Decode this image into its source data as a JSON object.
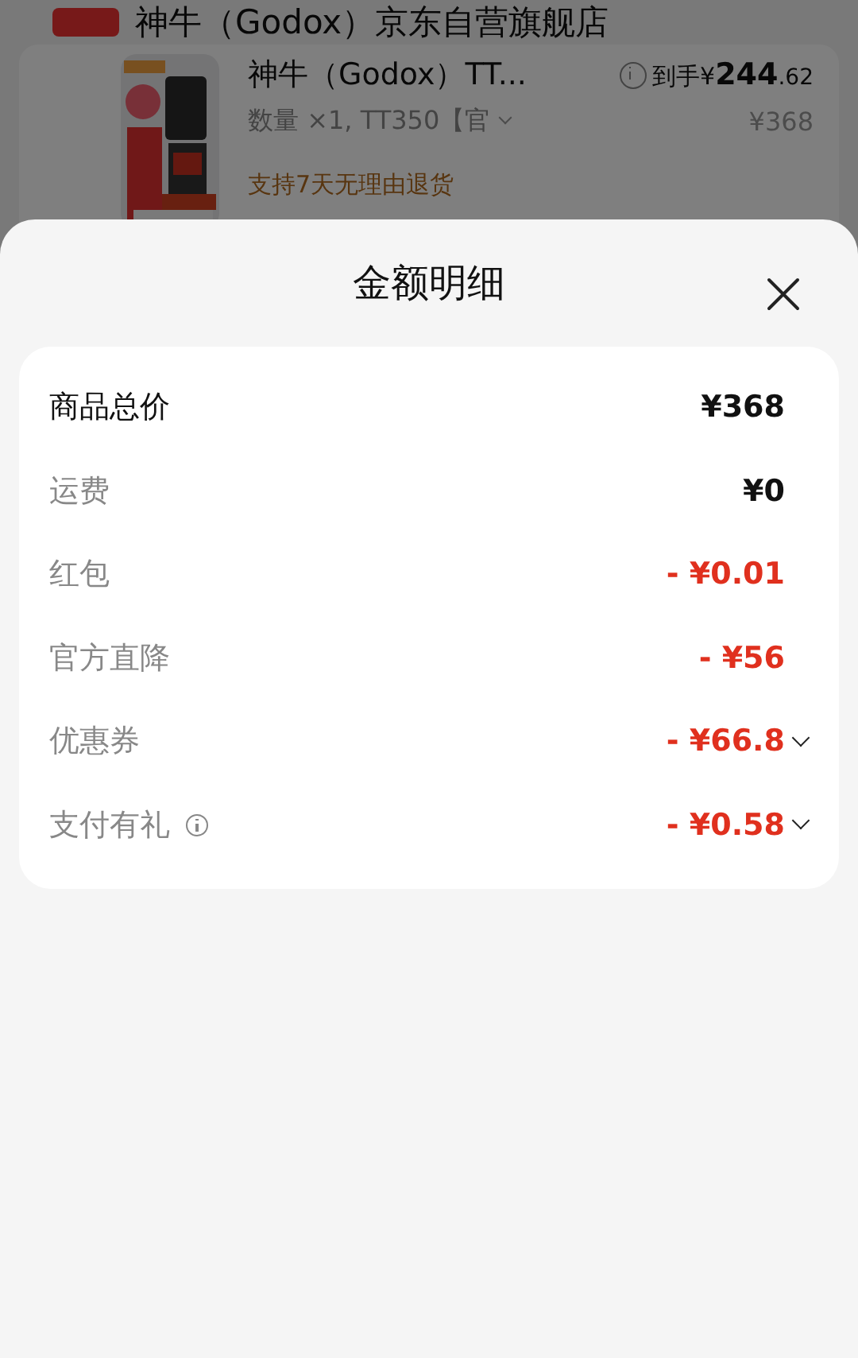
{
  "background_page": {
    "store_name": "神牛（Godox）京东自营旗舰店",
    "product": {
      "kind": "picture",
      "title": "神牛（Godox）TT...",
      "spec": "数量 ×1, TT350【官",
      "final_price_label": "到手",
      "final_price_currency": "¥",
      "final_price_integer": "244",
      "final_price_decimal": ".62",
      "original_price": "¥368",
      "service_note": "支持7天无理由退货"
    }
  },
  "sheet": {
    "title": "金额明细",
    "rows": [
      {
        "label": "商品总价",
        "value": "¥368",
        "kind": "total",
        "info": false,
        "expandable": false
      },
      {
        "label": "运费",
        "value": "¥0",
        "kind": "fee",
        "info": false,
        "expandable": false
      },
      {
        "label": "红包",
        "value": "- ¥0.01",
        "kind": "discount",
        "info": false,
        "expandable": false
      },
      {
        "label": "官方直降",
        "value": "- ¥56",
        "kind": "discount",
        "info": false,
        "expandable": false
      },
      {
        "label": "优惠券",
        "value": "- ¥66.8",
        "kind": "discount",
        "info": false,
        "expandable": true
      },
      {
        "label": "支付有礼",
        "value": "- ¥0.58",
        "kind": "discount",
        "info": true,
        "expandable": true
      }
    ]
  }
}
